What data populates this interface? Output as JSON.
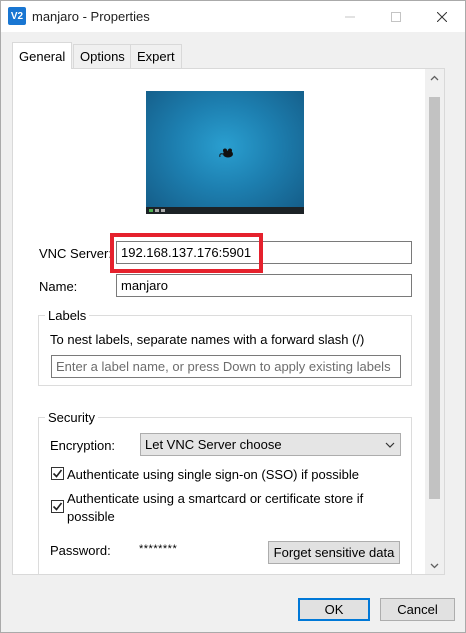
{
  "window": {
    "title": "manjaro - Properties",
    "app_icon_text": "V2"
  },
  "tabs": [
    {
      "label": "General",
      "active": true
    },
    {
      "label": "Options",
      "active": false
    },
    {
      "label": "Expert",
      "active": false
    }
  ],
  "general": {
    "vnc_server_label": "VNC Server:",
    "vnc_server_value": "192.168.137.176:5901",
    "name_label": "Name:",
    "name_value": "manjaro",
    "labels_group_title": "Labels",
    "labels_hint": "To nest labels, separate names with a forward slash (/)",
    "labels_placeholder": "Enter a label name, or press Down to apply existing labels",
    "security_group_title": "Security",
    "encryption_label": "Encryption:",
    "encryption_value": "Let VNC Server choose",
    "sso_label": "Authenticate using single sign-on (SSO) if possible",
    "sso_checked": true,
    "smartcard_label_line1": "Authenticate using a smartcard or certificate store if",
    "smartcard_label_line2": "possible",
    "smartcard_checked": true,
    "password_label": "Password:",
    "password_value": "********",
    "forget_button": "Forget sensitive data"
  },
  "footer": {
    "ok_label": "OK",
    "cancel_label": "Cancel"
  },
  "colors": {
    "highlight": "#e5212d",
    "accent": "#0078d7"
  }
}
